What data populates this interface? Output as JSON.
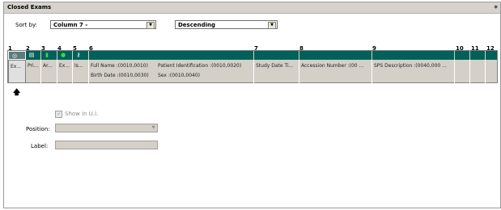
{
  "panel": {
    "title": "Closed Exams"
  },
  "sort": {
    "label": "Sort by:",
    "column_value": "Column 7 -",
    "order_value": "Descending"
  },
  "columns": {
    "numbers": [
      "1",
      "2",
      "3",
      "4",
      "5",
      "6",
      "7",
      "8",
      "9",
      "10",
      "11",
      "12"
    ],
    "header_icons": [
      "eye-icon",
      "printer-icon",
      "archive-icon",
      "exam-status-icon",
      "key-icon"
    ],
    "row_cells": [
      "Ex...",
      "Pri...",
      "Ar...",
      "Ex...",
      "Is...",
      "Full Name :(0010,0010)",
      "Patient Identification :(0010,0020)",
      "Birth Date :(0010,0030)",
      "Sex :(0010,0040)",
      "Study Date Ti...",
      "Accession Number :(00 ...",
      "SPS Description :(0040,000 ..."
    ]
  },
  "form": {
    "show_in_ui_label": "Show in U.I.",
    "position_label": "Position:",
    "label_label": "Label:"
  }
}
